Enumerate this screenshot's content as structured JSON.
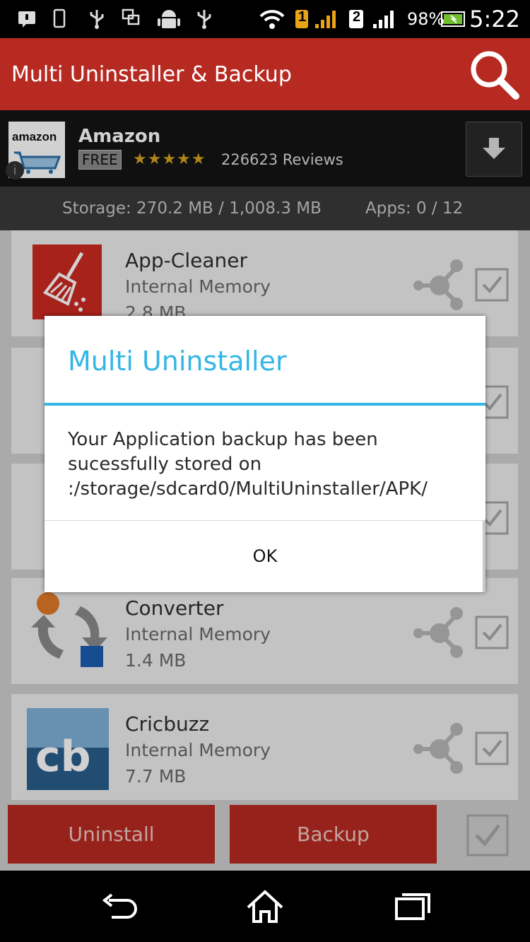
{
  "status_bar": {
    "battery_percent": "98%",
    "time": "5:22",
    "sim1_label": "1",
    "sim2_label": "2"
  },
  "action_bar": {
    "title": "Multi Uninstaller & Backup",
    "search_icon": "search-icon"
  },
  "ad": {
    "logo_text": "amazon",
    "name": "Amazon",
    "price": "FREE",
    "stars": "★★★★★",
    "reviews": "226623 Reviews",
    "download_icon": "download-icon"
  },
  "storage": {
    "text": "Storage: 270.2 MB / 1,008.3 MB",
    "apps": "Apps: 0 / 12"
  },
  "apps": [
    {
      "name": "App-Cleaner",
      "location": "Internal Memory",
      "size": "2.8 MB"
    },
    {
      "name": "",
      "location": "",
      "size": ""
    },
    {
      "name": "",
      "location": "",
      "size": ""
    },
    {
      "name": "Converter",
      "location": "Internal Memory",
      "size": "1.4 MB"
    },
    {
      "name": "Cricbuzz",
      "location": "Internal Memory",
      "size": "7.7 MB",
      "icon_text": "cb"
    }
  ],
  "buttons": {
    "uninstall": "Uninstall",
    "backup": "Backup"
  },
  "dialog": {
    "title": "Multi Uninstaller",
    "message": "Your Application backup has been sucessfully stored on :/storage/sdcard0/MultiUninstaller/APK/",
    "ok": "OK"
  },
  "colors": {
    "accent_red": "#b72a22",
    "dialog_blue": "#33b5e5"
  }
}
